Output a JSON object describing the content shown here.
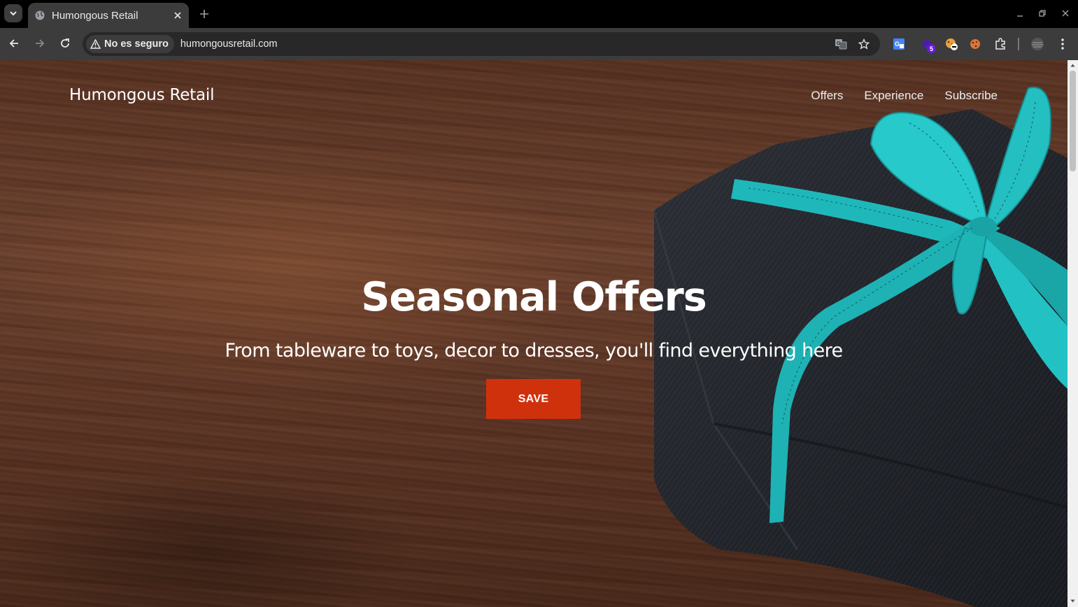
{
  "browser": {
    "tab_title": "Humongous Retail",
    "security_label": "No es seguro",
    "url": "humongousretail.com",
    "extension_badge": "5"
  },
  "site": {
    "brand": "Humongous Retail",
    "nav": [
      "Offers",
      "Experience",
      "Subscribe"
    ]
  },
  "hero": {
    "title": "Seasonal Offers",
    "subtitle": "From tableware to toys, decor to dresses, you'll find everything here",
    "button_label": "SAVE"
  },
  "colors": {
    "accent_button": "#d0310d",
    "ribbon": "#1fb8ba",
    "gift_wrap": "#1e2126"
  },
  "icons": [
    "tab-search-icon",
    "globe-icon",
    "close-icon",
    "plus-icon",
    "back-icon",
    "forward-icon",
    "reload-icon",
    "warning-icon",
    "translate-icon",
    "star-icon",
    "extensions-icon",
    "menu-icon"
  ]
}
